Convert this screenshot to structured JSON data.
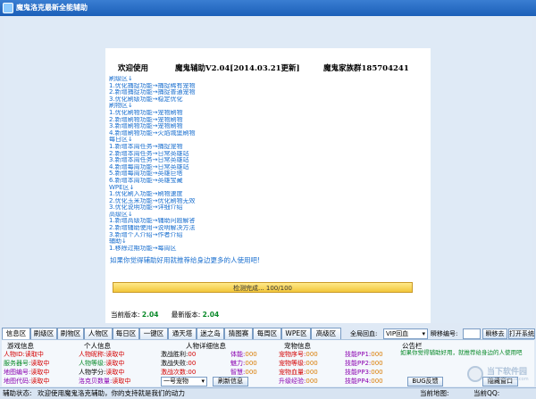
{
  "window": {
    "title": "魔鬼洛克最新全能辅助"
  },
  "header": {
    "welcome": "欢迎使用",
    "version": "魔鬼辅助V2.04[2014.03.21更新]",
    "group": "魔鬼家族群185704241"
  },
  "notes": [
    "刷级区↓",
    "1.优化捕捉功能→捕捉稀有宠物",
    "2.新增捕捉功能→捕捉普通宠物",
    "3.优化刷级功能→稳定优化",
    "刷物区↓",
    "1.优化刷物功能→宠物刷物",
    "2.新增刷物功能→宠物刷物",
    "3.新增刷物功能→宠物刷物",
    "4.新增刷物功能→火焰城堡刷物",
    "每日区↓",
    "1.新增本周任务→捕捉宠物",
    "2.新增本周任务→日常英雄站",
    "3.新增本周任务→日常英雄站",
    "4.新增每周功能→日常英雄站",
    "5.新增每周功能→英雄巨塔",
    "6.新增本周功能→英雄宝藏",
    "WPE区↓",
    "1.优化刷入功能→刷物速度",
    "2.优化玉米功能→优化刷物无效",
    "3.优化说明功能→详细介绍",
    "高级区↓",
    "1.新增高级功能→辅助问题解答",
    "2.新增辅助使用→说明解决方法",
    "3.新增个人介绍→作者介绍",
    "辅助↓",
    "1.移除过期功能→每周区"
  ],
  "share_text": "如果你觉得辅助好用就推荐给身边更多的人使用吧!",
  "progress": {
    "label": "检测完成... 100/100",
    "value": 100,
    "max": 100
  },
  "versions": {
    "current_label": "当前版本:",
    "current": "2.04",
    "latest_label": "最新版本:",
    "latest": "2.04"
  },
  "tabs": [
    "信息区",
    "刷级区",
    "刷物区",
    "人物区",
    "每日区",
    "一键区",
    "通天塔",
    "迷之岛",
    "猜图赛",
    "每周区",
    "WPE区",
    "高级区"
  ],
  "controls": {
    "recovery_label": "全局回血:",
    "recovery_value": "VIP回血",
    "instant_label": "瞬移编号:",
    "instant_btn": "瞬移去",
    "open_btn": "打开系统"
  },
  "panels": {
    "game": {
      "title": "游戏信息",
      "rows": [
        {
          "label": "人物ID:",
          "value": "读取中"
        },
        {
          "label": "服务器号:",
          "value": "读取中"
        },
        {
          "label": "地图编号:",
          "value": "读取中"
        },
        {
          "label": "地图代码:",
          "value": "读取中"
        }
      ]
    },
    "personal": {
      "title": "个人信息",
      "rows": [
        {
          "label": "人物昵称:",
          "value": "读取中"
        },
        {
          "label": "人物等级:",
          "value": "读取中"
        },
        {
          "label": "人物学分:",
          "value": "读取中"
        },
        {
          "label": "洛克贝数量:",
          "value": "读取中"
        }
      ]
    },
    "detail": {
      "title": "人物详细信息",
      "rows": [
        {
          "label": "激战胜利:",
          "value": "00",
          "label2": "体能:",
          "value2": "000"
        },
        {
          "label": "激战失败:",
          "value": "00",
          "label2": "魅力:",
          "value2": "000"
        },
        {
          "label": "激战次数:",
          "value": "00",
          "label2": "智慧:",
          "value2": "000"
        }
      ],
      "select_value": "一号宠物",
      "refresh_btn": "刷新信息"
    },
    "pet": {
      "title": "宠物信息",
      "rows": [
        {
          "label": "宠物序号:",
          "value": "000",
          "label2": "技能PP1:",
          "value2": "000"
        },
        {
          "label": "宠物等级:",
          "value": "000",
          "label2": "技能PP2:",
          "value2": "000"
        },
        {
          "label": "宠物血量:",
          "value": "000",
          "label2": "技能PP3:",
          "value2": "000"
        },
        {
          "label": "升级经验:",
          "value": "000",
          "label2": "技能PP4:",
          "value2": "000"
        }
      ]
    },
    "notice": {
      "title": "公告栏",
      "text": "如果你觉得辅助好用，就推荐给身边的人使用吧",
      "bug_btn": "BUG反馈",
      "hide_btn": "隐藏窗口"
    }
  },
  "status": {
    "label": "辅助状态:",
    "text": "欢迎使用魔鬼洛克辅助，你的支持就是我们的动力",
    "map_label": "当前地图:",
    "qq_label": "当前QQ:"
  },
  "watermark": {
    "name": "当下软件园",
    "url": "www.downxia.com"
  },
  "colors": {
    "titlebar": "#1b5fb8",
    "notes_text": "#1a6fcf",
    "version_value": "#0a8a2a",
    "reading": "#d40000"
  }
}
